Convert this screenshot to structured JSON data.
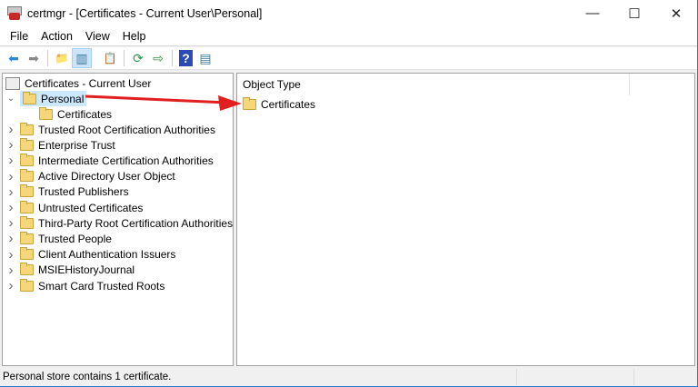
{
  "window": {
    "title": "certmgr - [Certificates - Current User\\Personal]",
    "minimize": "—",
    "maximize": "☐",
    "close": "✕"
  },
  "menu": [
    "File",
    "Action",
    "View",
    "Help"
  ],
  "toolbar": [
    {
      "icon": "back-arrow-icon",
      "glyph": "⬅"
    },
    {
      "icon": "forward-arrow-icon",
      "glyph": "➡"
    },
    {
      "icon": "up-folder-icon",
      "glyph": "📁"
    },
    {
      "icon": "show-hide-console-tree-icon",
      "glyph": "▥"
    },
    {
      "icon": "clipboard-icon",
      "glyph": "📋"
    },
    {
      "icon": "refresh-icon",
      "glyph": "⟳"
    },
    {
      "icon": "export-list-icon",
      "glyph": "⇨"
    },
    {
      "icon": "help-icon",
      "glyph": "?"
    },
    {
      "icon": "show-action-pane-icon",
      "glyph": "▤"
    }
  ],
  "tree": {
    "root": "Certificates - Current User",
    "items": [
      {
        "label": "Personal",
        "expanded": true,
        "selected": true,
        "children": [
          "Certificates"
        ]
      },
      {
        "label": "Trusted Root Certification Authorities"
      },
      {
        "label": "Enterprise Trust"
      },
      {
        "label": "Intermediate Certification Authorities"
      },
      {
        "label": "Active Directory User Object"
      },
      {
        "label": "Trusted Publishers"
      },
      {
        "label": "Untrusted Certificates"
      },
      {
        "label": "Third-Party Root Certification Authorities"
      },
      {
        "label": "Trusted People"
      },
      {
        "label": "Client Authentication Issuers"
      },
      {
        "label": "MSIEHistoryJournal"
      },
      {
        "label": "Smart Card Trusted Roots"
      }
    ]
  },
  "list": {
    "column": "Object Type",
    "items": [
      "Certificates"
    ]
  },
  "status": "Personal store contains 1 certificate.",
  "colors": {
    "selection": "#cce8ff",
    "annotation_arrow": "#e02020",
    "window_border": "#2b78c5"
  }
}
